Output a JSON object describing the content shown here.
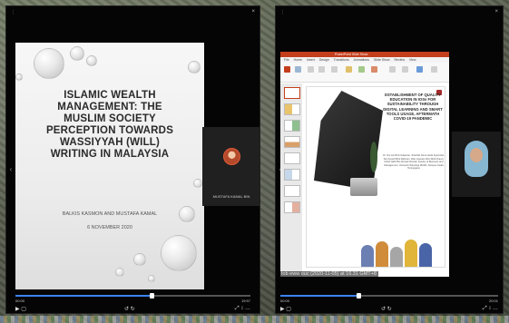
{
  "left_player": {
    "nav_prev_icon": "chevron-left-icon",
    "nav_next_icon": "chevron-right-icon",
    "slide": {
      "title": "ISLAMIC WEALTH MANAGEMENT: THE MUSLIM SOCIETY PERCEPTION TOWARDS WASSIYYAH (WILL) WRITING IN MALAYSIA",
      "authors": "BALKIS KASMON AND MUSTAFA KAMAL",
      "date": "6 NOVEMBER 2020"
    },
    "participant": {
      "name": "MUSTAFA KAMAL BIN"
    },
    "playback": {
      "progress": 0.58,
      "time_start": "00:00",
      "time_end": "19:57",
      "controls_center": "↺ ↻",
      "controls_right": "⤢ ↕ …"
    }
  },
  "right_player": {
    "ppt": {
      "window_title": "PowerPoint Slide Show",
      "menu": [
        "File",
        "Home",
        "Insert",
        "Design",
        "Transitions",
        "Animations",
        "Slide Show",
        "Review",
        "View"
      ],
      "slide_title": "ESTABLISHMENT OF QUALITY EDUCATION IN IOSs FOR SUSTAINABILITY THROUGH DIGITAL LEARNING AND SMART TOOLS USAGE, AFTERMATH COVID-19 PANDEMIC",
      "slide_authors": "Dr. Nur Ain Binti Sulaiman, Sharifah Nurul Huda Syed Alwi, Nor Asyiah Binti Rahman, Wan Hussain Wan Mohd Fauzi, Mohd Hafiz Bin Ahmad Ghazali. Faculty of Business and Management, Universiti Teknologi MARA, Kampus Kuala Terengganu"
    },
    "caption": "tob eww ouc (2020-11-05) at 16.31 GMT+8",
    "participant": {
      "name": ""
    },
    "playback": {
      "progress": 0.36,
      "time_start": "00:00",
      "time_end": "20:01",
      "controls_center": "↺ ↻",
      "controls_right": "⤢ ↕ …"
    }
  },
  "colors": {
    "ppt_accent": "#c43e1c",
    "progress": "#3b82f6",
    "player_bg": "#050505"
  }
}
